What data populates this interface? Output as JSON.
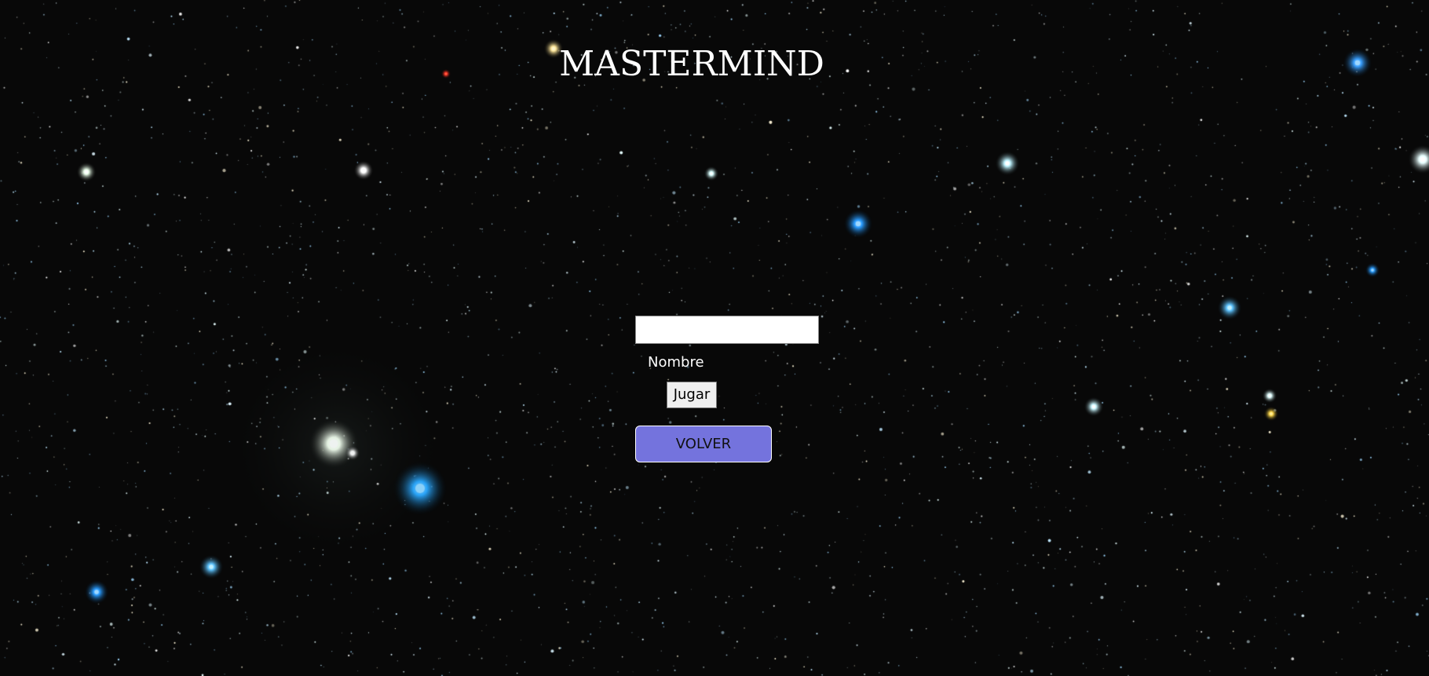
{
  "page": {
    "title": "MASTERMIND"
  },
  "form": {
    "name_value": "",
    "name_label": "Nombre",
    "play_label": "Jugar"
  },
  "nav": {
    "back_label": "VOLVER"
  },
  "colors": {
    "background": "#080808",
    "back_button": "#7473dd",
    "text": "#ffffff"
  }
}
